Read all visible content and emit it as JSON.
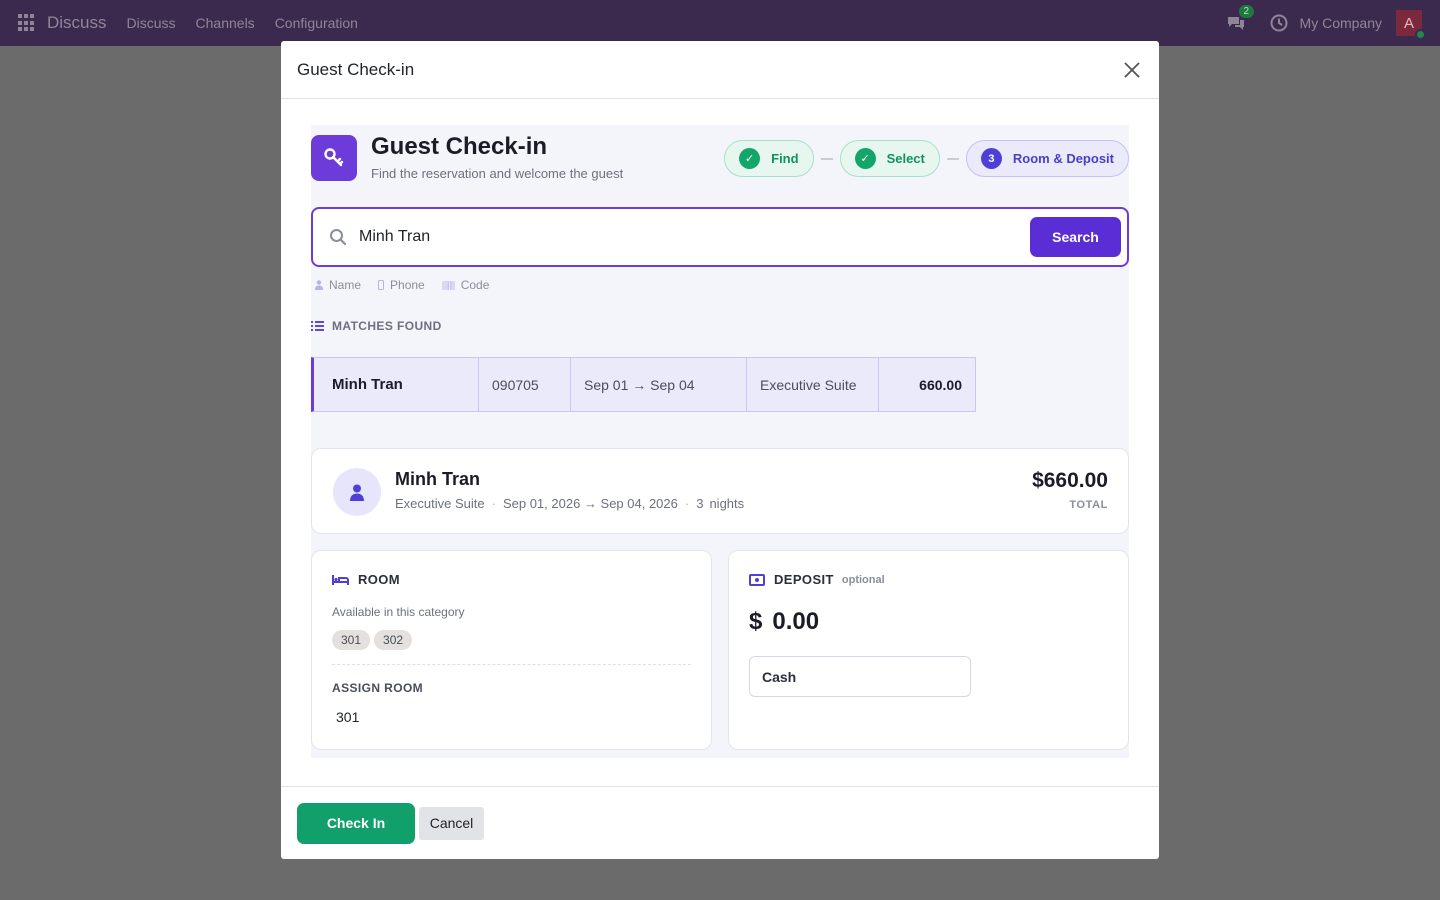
{
  "navbar": {
    "brand": "Discuss",
    "menu": [
      "Discuss",
      "Channels",
      "Configuration"
    ],
    "chat_badge": "2",
    "company": "My Company",
    "avatar_letter": "A"
  },
  "modal": {
    "title": "Guest Check-in"
  },
  "hero": {
    "title": "Guest Check-in",
    "subtitle": "Find the reservation and welcome the guest"
  },
  "steps": [
    {
      "marker": "✓",
      "label": "Find",
      "state": "done"
    },
    {
      "marker": "✓",
      "label": "Select",
      "state": "done"
    },
    {
      "marker": "3",
      "label": "Room & Deposit",
      "state": "current"
    }
  ],
  "search": {
    "value": "Minh Tran",
    "button_label": "Search"
  },
  "filters": [
    "Name",
    "Phone",
    "Code"
  ],
  "matches": {
    "label": "MATCHES FOUND",
    "rows": [
      {
        "name": "Minh Tran",
        "code": "090705",
        "dates": "Sep 01 → Sep 04",
        "room_type": "Executive Suite",
        "amount": "660.00"
      }
    ]
  },
  "guest": {
    "name": "Minh Tran",
    "room_type": "Executive Suite",
    "dates": "Sep 01, 2026 → Sep 04, 2026",
    "nights_count": "3",
    "nights_label": "nights",
    "total": "$660.00",
    "total_label": "TOTAL"
  },
  "room_panel": {
    "title": "ROOM",
    "available_label": "Available in this category",
    "available_rooms": [
      "301",
      "302"
    ],
    "assign_label": "ASSIGN ROOM",
    "assigned": "301"
  },
  "deposit_panel": {
    "title": "DEPOSIT",
    "optional_label": "optional",
    "currency": "$",
    "amount": "0.00",
    "method": "Cash"
  },
  "footer": {
    "checkin_label": "Check In",
    "cancel_label": "Cancel"
  },
  "colors": {
    "accent": "#6d3bd9",
    "success": "#11a06b",
    "navbar": "#3c2a4e"
  }
}
